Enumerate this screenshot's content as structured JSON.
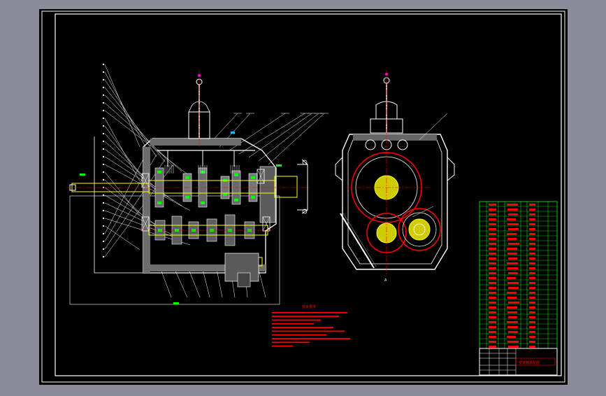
{
  "colors": {
    "background": "#8a8d99",
    "sheet": "#000000",
    "frame": "#ffffff",
    "body_line": "#ffffff",
    "leader": "#ffffff",
    "section": "#7a7a7a",
    "shaft": "#ffff00",
    "centerline": "#ff0000",
    "gear_fill": "#00ff00",
    "gear_outline": "#ff0000",
    "notes_text": "#ff0000",
    "notes_title": "#ff0000",
    "table_grid": "#00ff00",
    "table_text": "#ff0000",
    "title_block": "#ffffff"
  },
  "drawing": {
    "section_label": "A",
    "notes_title": "技术要求",
    "title_block_name": "变速器装配图"
  }
}
